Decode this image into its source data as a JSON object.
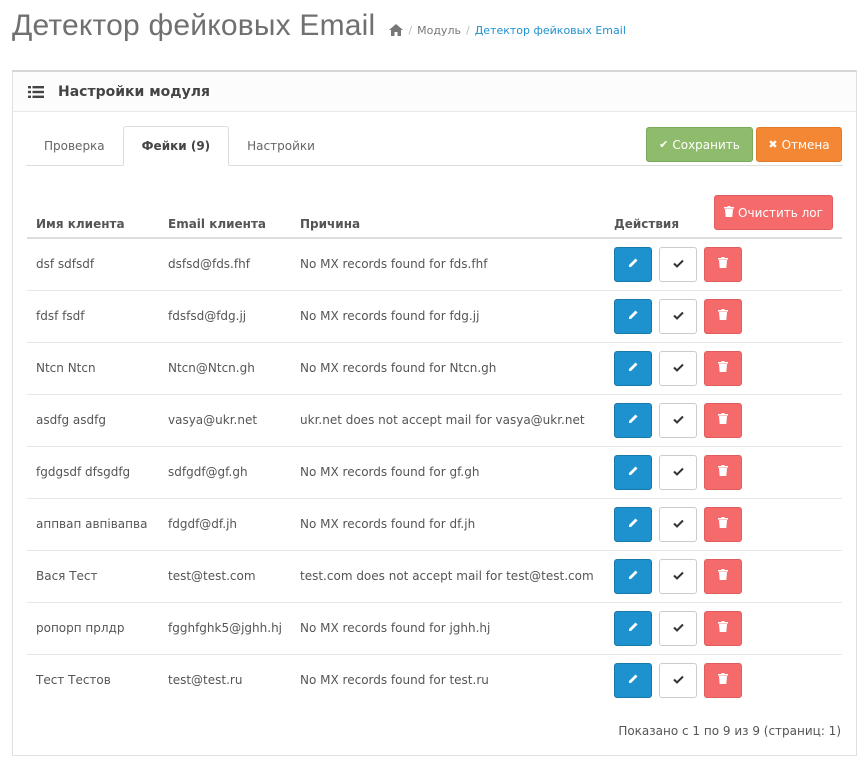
{
  "header": {
    "title": "Детектор фейковых Email",
    "breadcrumb": [
      "Модуль",
      "Детектор фейковых Email"
    ],
    "home_icon": "home-icon"
  },
  "panel": {
    "title": "Настройки модуля",
    "icon": "list-icon"
  },
  "tabs": [
    {
      "label": "Проверка",
      "active": false
    },
    {
      "label": "Фейки (9)",
      "active": true
    },
    {
      "label": "Настройки",
      "active": false
    }
  ],
  "buttons": {
    "save_label": "Сохранить",
    "cancel_label": "Отмена",
    "clear_log_label": "Очистить лог"
  },
  "table": {
    "headers": [
      "Имя клиента",
      "Email клиента",
      "Причина",
      "Действия"
    ],
    "rows": [
      {
        "name": "dsf sdfsdf",
        "email": "dsfsd@fds.fhf",
        "reason": "No MX records found for fds.fhf"
      },
      {
        "name": "fdsf fsdf",
        "email": "fdsfsd@fdg.jj",
        "reason": "No MX records found for fdg.jj"
      },
      {
        "name": "Ntcn Ntcn",
        "email": "Ntcn@Ntcn.gh",
        "reason": "No MX records found for Ntcn.gh"
      },
      {
        "name": "asdfg asdfg",
        "email": "vasya@ukr.net",
        "reason": "ukr.net does not accept mail for vasya@ukr.net"
      },
      {
        "name": "fgdgsdf dfsgdfg",
        "email": "sdfgdf@gf.gh",
        "reason": "No MX records found for gf.gh"
      },
      {
        "name": "аппвап авпівапва",
        "email": "fdgdf@df.jh",
        "reason": "No MX records found for df.jh"
      },
      {
        "name": "Вася Тест",
        "email": "test@test.com",
        "reason": "test.com does not accept mail for test@test.com"
      },
      {
        "name": "ропорп прлдр",
        "email": "fgghfghk5@jghh.hj",
        "reason": "No MX records found for jghh.hj"
      },
      {
        "name": "Тест Тестов",
        "email": "test@test.ru",
        "reason": "No MX records found for test.ru"
      }
    ]
  },
  "pagination": {
    "info": "Показано с 1 по 9 из 9 (страниц: 1)"
  },
  "colors": {
    "primary": "#1e91cf",
    "success": "#8fbb6c",
    "warning": "#f38733",
    "danger": "#f56b6b"
  }
}
